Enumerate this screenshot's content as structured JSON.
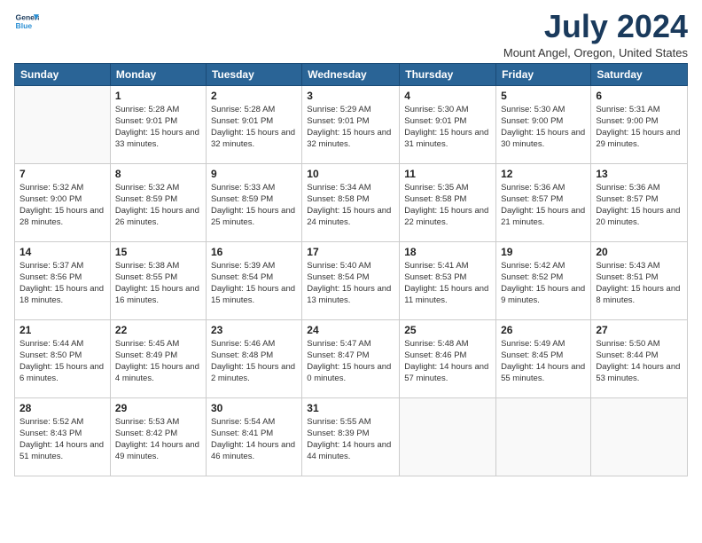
{
  "header": {
    "logo_line1": "General",
    "logo_line2": "Blue",
    "month": "July 2024",
    "location": "Mount Angel, Oregon, United States"
  },
  "weekdays": [
    "Sunday",
    "Monday",
    "Tuesday",
    "Wednesday",
    "Thursday",
    "Friday",
    "Saturday"
  ],
  "weeks": [
    [
      {
        "day": "",
        "info": ""
      },
      {
        "day": "1",
        "info": "Sunrise: 5:28 AM\nSunset: 9:01 PM\nDaylight: 15 hours\nand 33 minutes."
      },
      {
        "day": "2",
        "info": "Sunrise: 5:28 AM\nSunset: 9:01 PM\nDaylight: 15 hours\nand 32 minutes."
      },
      {
        "day": "3",
        "info": "Sunrise: 5:29 AM\nSunset: 9:01 PM\nDaylight: 15 hours\nand 32 minutes."
      },
      {
        "day": "4",
        "info": "Sunrise: 5:30 AM\nSunset: 9:01 PM\nDaylight: 15 hours\nand 31 minutes."
      },
      {
        "day": "5",
        "info": "Sunrise: 5:30 AM\nSunset: 9:00 PM\nDaylight: 15 hours\nand 30 minutes."
      },
      {
        "day": "6",
        "info": "Sunrise: 5:31 AM\nSunset: 9:00 PM\nDaylight: 15 hours\nand 29 minutes."
      }
    ],
    [
      {
        "day": "7",
        "info": "Sunrise: 5:32 AM\nSunset: 9:00 PM\nDaylight: 15 hours\nand 28 minutes."
      },
      {
        "day": "8",
        "info": "Sunrise: 5:32 AM\nSunset: 8:59 PM\nDaylight: 15 hours\nand 26 minutes."
      },
      {
        "day": "9",
        "info": "Sunrise: 5:33 AM\nSunset: 8:59 PM\nDaylight: 15 hours\nand 25 minutes."
      },
      {
        "day": "10",
        "info": "Sunrise: 5:34 AM\nSunset: 8:58 PM\nDaylight: 15 hours\nand 24 minutes."
      },
      {
        "day": "11",
        "info": "Sunrise: 5:35 AM\nSunset: 8:58 PM\nDaylight: 15 hours\nand 22 minutes."
      },
      {
        "day": "12",
        "info": "Sunrise: 5:36 AM\nSunset: 8:57 PM\nDaylight: 15 hours\nand 21 minutes."
      },
      {
        "day": "13",
        "info": "Sunrise: 5:36 AM\nSunset: 8:57 PM\nDaylight: 15 hours\nand 20 minutes."
      }
    ],
    [
      {
        "day": "14",
        "info": "Sunrise: 5:37 AM\nSunset: 8:56 PM\nDaylight: 15 hours\nand 18 minutes."
      },
      {
        "day": "15",
        "info": "Sunrise: 5:38 AM\nSunset: 8:55 PM\nDaylight: 15 hours\nand 16 minutes."
      },
      {
        "day": "16",
        "info": "Sunrise: 5:39 AM\nSunset: 8:54 PM\nDaylight: 15 hours\nand 15 minutes."
      },
      {
        "day": "17",
        "info": "Sunrise: 5:40 AM\nSunset: 8:54 PM\nDaylight: 15 hours\nand 13 minutes."
      },
      {
        "day": "18",
        "info": "Sunrise: 5:41 AM\nSunset: 8:53 PM\nDaylight: 15 hours\nand 11 minutes."
      },
      {
        "day": "19",
        "info": "Sunrise: 5:42 AM\nSunset: 8:52 PM\nDaylight: 15 hours\nand 9 minutes."
      },
      {
        "day": "20",
        "info": "Sunrise: 5:43 AM\nSunset: 8:51 PM\nDaylight: 15 hours\nand 8 minutes."
      }
    ],
    [
      {
        "day": "21",
        "info": "Sunrise: 5:44 AM\nSunset: 8:50 PM\nDaylight: 15 hours\nand 6 minutes."
      },
      {
        "day": "22",
        "info": "Sunrise: 5:45 AM\nSunset: 8:49 PM\nDaylight: 15 hours\nand 4 minutes."
      },
      {
        "day": "23",
        "info": "Sunrise: 5:46 AM\nSunset: 8:48 PM\nDaylight: 15 hours\nand 2 minutes."
      },
      {
        "day": "24",
        "info": "Sunrise: 5:47 AM\nSunset: 8:47 PM\nDaylight: 15 hours\nand 0 minutes."
      },
      {
        "day": "25",
        "info": "Sunrise: 5:48 AM\nSunset: 8:46 PM\nDaylight: 14 hours\nand 57 minutes."
      },
      {
        "day": "26",
        "info": "Sunrise: 5:49 AM\nSunset: 8:45 PM\nDaylight: 14 hours\nand 55 minutes."
      },
      {
        "day": "27",
        "info": "Sunrise: 5:50 AM\nSunset: 8:44 PM\nDaylight: 14 hours\nand 53 minutes."
      }
    ],
    [
      {
        "day": "28",
        "info": "Sunrise: 5:52 AM\nSunset: 8:43 PM\nDaylight: 14 hours\nand 51 minutes."
      },
      {
        "day": "29",
        "info": "Sunrise: 5:53 AM\nSunset: 8:42 PM\nDaylight: 14 hours\nand 49 minutes."
      },
      {
        "day": "30",
        "info": "Sunrise: 5:54 AM\nSunset: 8:41 PM\nDaylight: 14 hours\nand 46 minutes."
      },
      {
        "day": "31",
        "info": "Sunrise: 5:55 AM\nSunset: 8:39 PM\nDaylight: 14 hours\nand 44 minutes."
      },
      {
        "day": "",
        "info": ""
      },
      {
        "day": "",
        "info": ""
      },
      {
        "day": "",
        "info": ""
      }
    ]
  ]
}
